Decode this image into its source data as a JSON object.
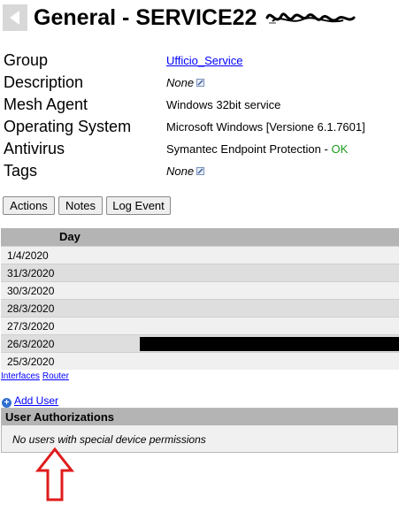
{
  "header": {
    "title": "General - SERVICE22",
    "back_icon": "back-arrow-icon"
  },
  "properties": {
    "group_label": "Group",
    "group_value": "Ufficio_Service",
    "description_label": "Description",
    "description_value": "None",
    "mesh_agent_label": "Mesh Agent",
    "mesh_agent_value": "Windows 32bit service",
    "os_label": "Operating System",
    "os_value": "Microsoft Windows [Versione 6.1.7601]",
    "antivirus_label": "Antivirus",
    "antivirus_value": "Symantec Endpoint Protection",
    "antivirus_sep": " - ",
    "antivirus_status": "OK",
    "tags_label": "Tags",
    "tags_value": "None"
  },
  "buttons": {
    "actions": "Actions",
    "notes": "Notes",
    "log_event": "Log Event"
  },
  "table": {
    "header": "Day",
    "rows": [
      "1/4/2020",
      "31/3/2020",
      "30/3/2020",
      "28/3/2020",
      "27/3/2020",
      "26/3/2020",
      "25/3/2020"
    ]
  },
  "links": {
    "interfaces": "Interfaces",
    "router": "Router"
  },
  "add_user": {
    "label": "Add User",
    "icon": "+"
  },
  "user_authorizations": {
    "title": "User Authorizations",
    "message": "No users with special device permissions"
  },
  "colors": {
    "link": "#0000ff",
    "ok": "#1a9b1a",
    "annotation_arrow": "#e01b1b",
    "header_bar": "#b4b4b4"
  }
}
